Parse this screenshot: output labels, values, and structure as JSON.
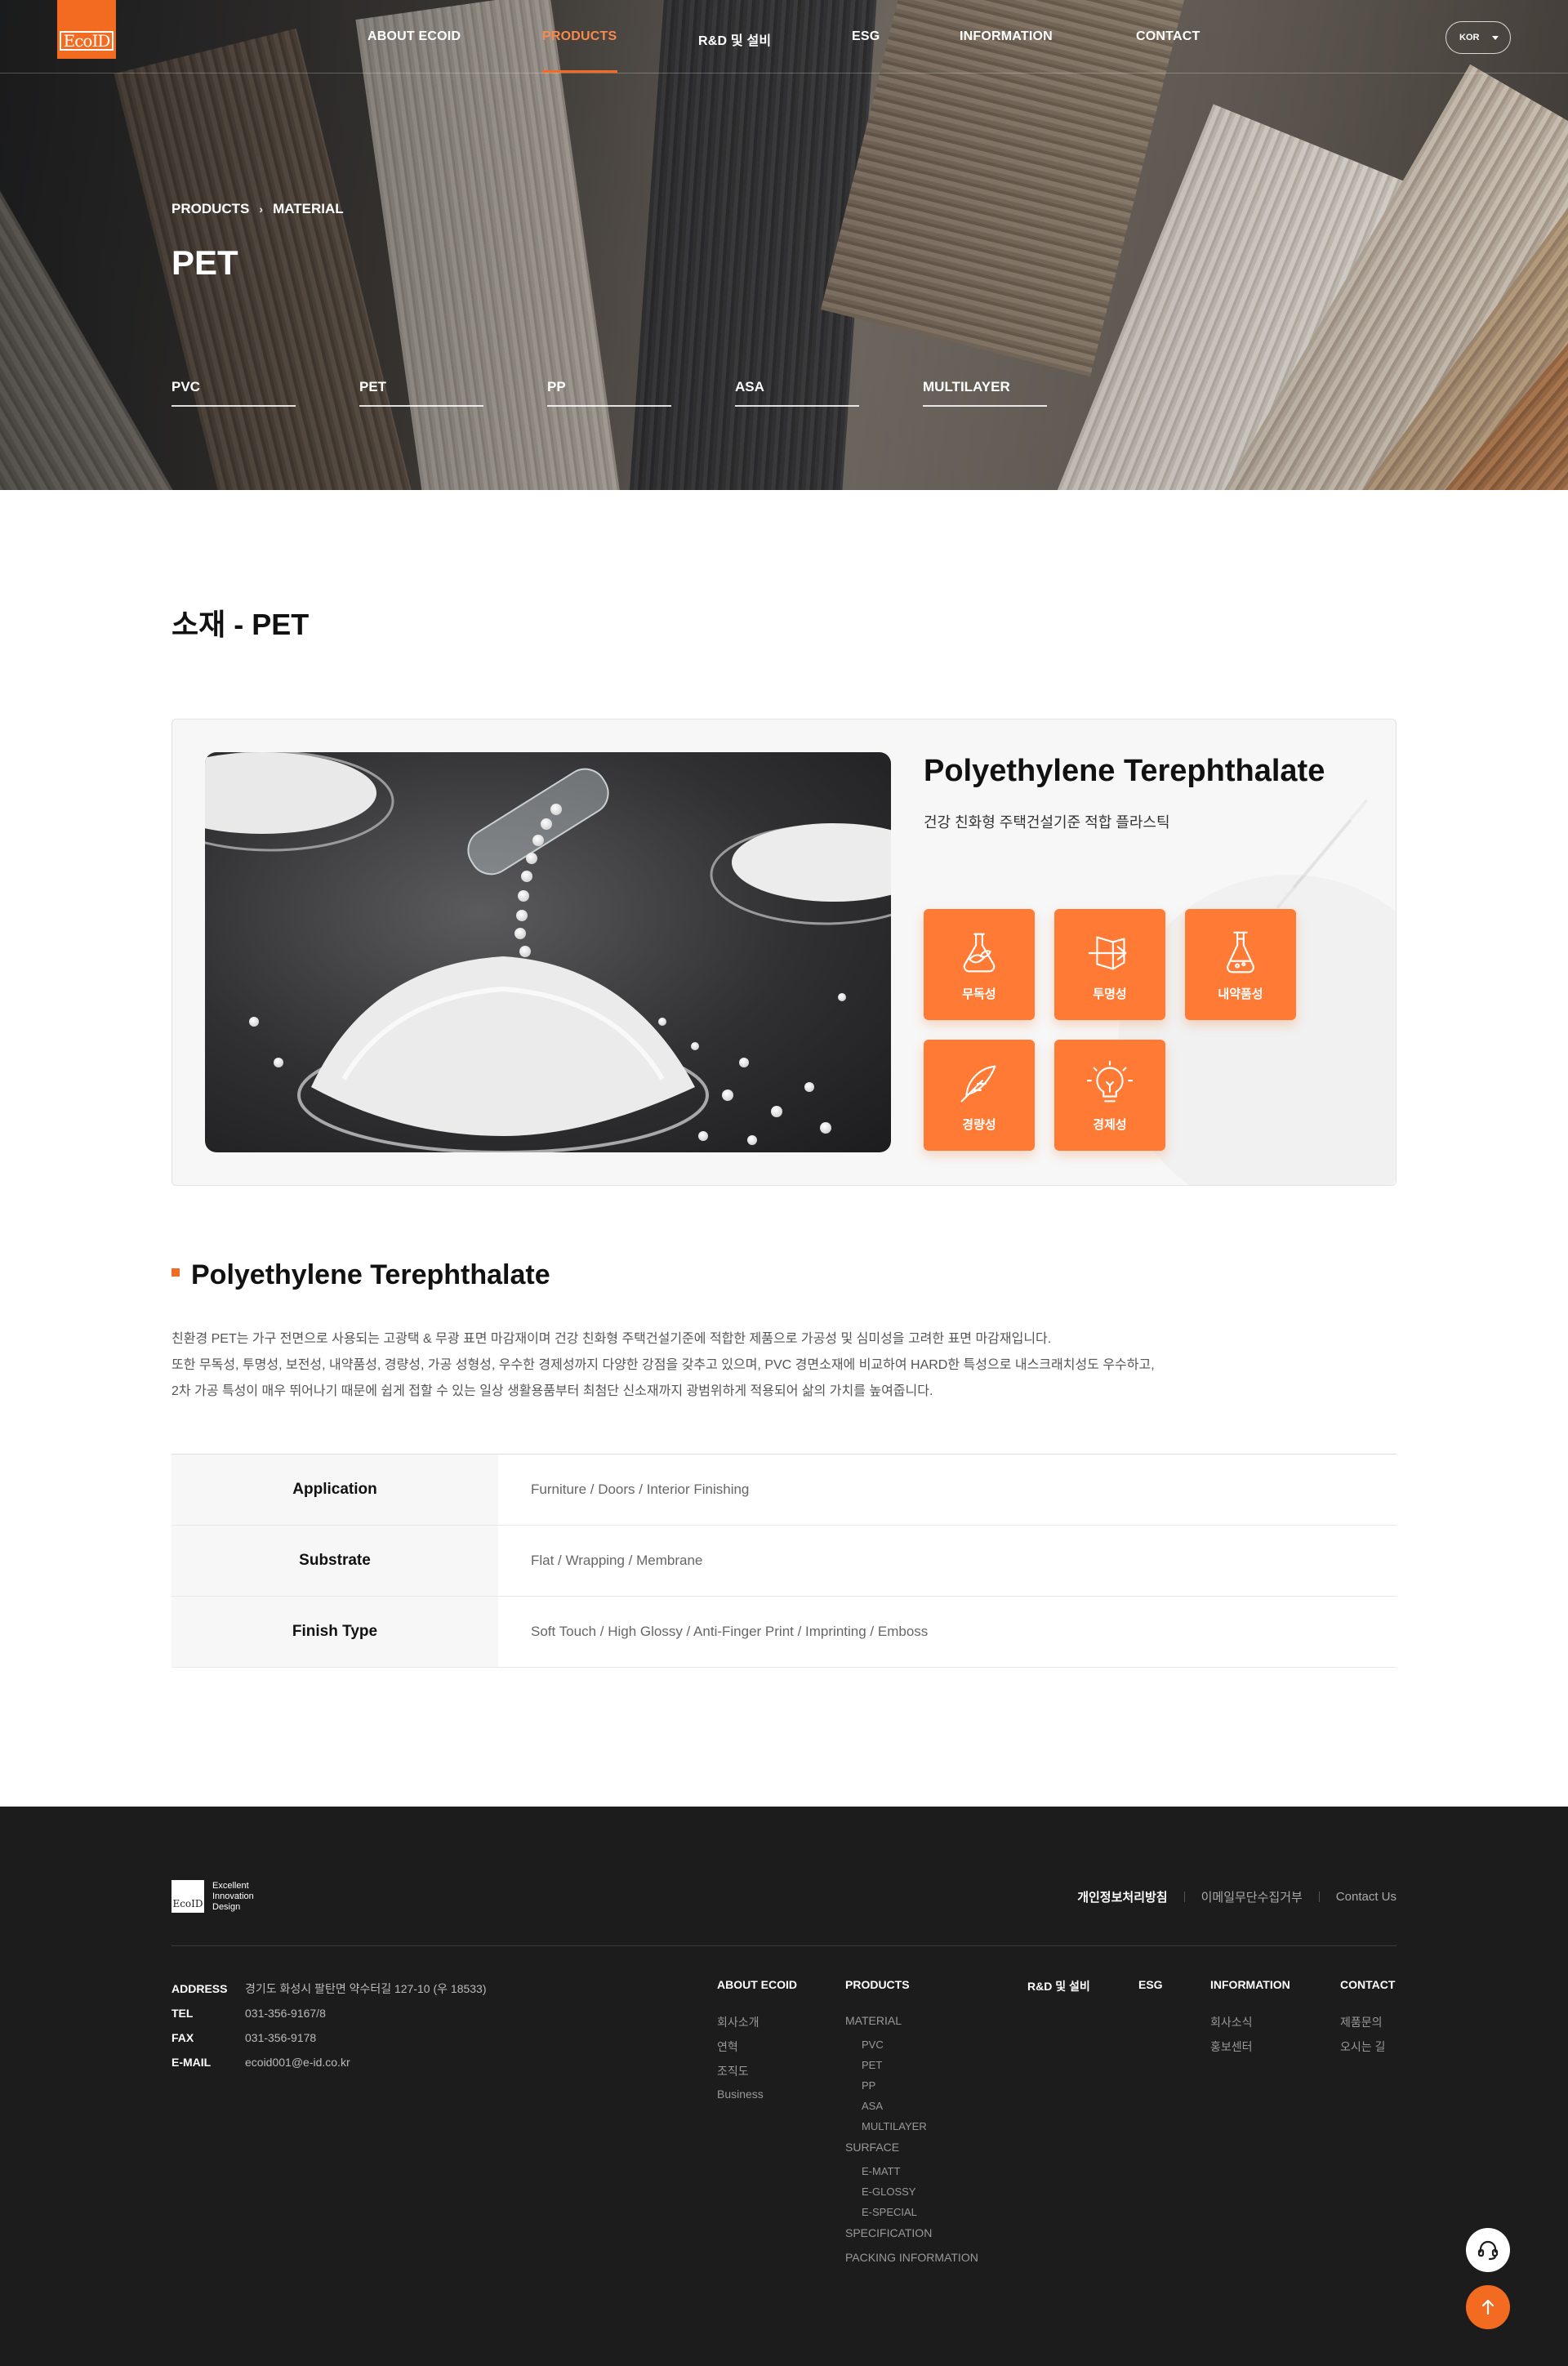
{
  "header": {
    "logo_text": "EcoID",
    "nav": [
      {
        "label": "ABOUT ECOID"
      },
      {
        "label": "PRODUCTS"
      },
      {
        "label": "R&D 및 설비"
      },
      {
        "label": "ESG"
      },
      {
        "label": "INFORMATION"
      },
      {
        "label": "CONTACT"
      }
    ],
    "active_nav": "PRODUCTS",
    "language": "KOR"
  },
  "hero": {
    "breadcrumb": [
      "PRODUCTS",
      "MATERIAL"
    ],
    "title": "PET",
    "subnav": [
      {
        "label": "PVC"
      },
      {
        "label": "PET"
      },
      {
        "label": "PP"
      },
      {
        "label": "ASA"
      },
      {
        "label": "MULTILAYER"
      }
    ]
  },
  "main": {
    "section_title": "소재 - PET",
    "product": {
      "name": "Polyethylene Terephthalate",
      "subtitle": "건강 친화형 주택건설기준 적합 플라스틱",
      "features": [
        {
          "label": "무독성",
          "icon": "flask-leaf-icon"
        },
        {
          "label": "투명성",
          "icon": "transparency-arrow-icon"
        },
        {
          "label": "내약품성",
          "icon": "chemical-flask-icon"
        },
        {
          "label": "경량성",
          "icon": "feather-icon"
        },
        {
          "label": "경제성",
          "icon": "lightbulb-icon"
        }
      ]
    },
    "detail_title": "Polyethylene Terephthalate",
    "description": [
      "친환경 PET는 가구 전면으로 사용되는 고광택 & 무광 표면 마감재이며 건강 친화형 주택건설기준에 적합한 제품으로 가공성 및 심미성을 고려한 표면 마감재입니다.",
      "또한 무독성, 투명성, 보전성, 내약품성, 경량성, 가공 성형성, 우수한 경제성까지 다양한 강점을 갖추고 있으며, PVC 경면소재에 비교하여 HARD한 특성으로 내스크래치성도 우수하고,",
      "2차 가공 특성이 매우 뛰어나기 때문에 쉽게 접할 수 있는 일상 생활용품부터 최첨단 신소재까지 광범위하게 적용되어 삶의 가치를 높여줍니다."
    ],
    "spec": [
      {
        "label": "Application",
        "value": "Furniture / Doors / Interior Finishing"
      },
      {
        "label": "Substrate",
        "value": "Flat / Wrapping / Membrane"
      },
      {
        "label": "Finish Type",
        "value": "Soft Touch / High Glossy / Anti-Finger Print / Imprinting / Emboss"
      }
    ]
  },
  "footer": {
    "logo_mark": "EcoID",
    "tagline": [
      "Excellent",
      "Innovation",
      "Design"
    ],
    "policy_links": [
      {
        "label": "개인정보처리방침"
      },
      {
        "label": "이메일무단수집거부"
      },
      {
        "label": "Contact Us"
      }
    ],
    "info": [
      {
        "key": "ADDRESS",
        "value": "경기도 화성시 팔탄면 약수터길 127-10 (우 18533)"
      },
      {
        "key": "TEL",
        "value": "031-356-9167/8"
      },
      {
        "key": "FAX",
        "value": "031-356-9178"
      },
      {
        "key": "E-MAIL",
        "value": "ecoid001@e-id.co.kr"
      }
    ],
    "sitemap": {
      "about": {
        "title": "ABOUT ECOID",
        "items": [
          "회사소개",
          "연혁",
          "조직도",
          "Business"
        ]
      },
      "products": {
        "title": "PRODUCTS",
        "material": "MATERIAL",
        "material_items": [
          "PVC",
          "PET",
          "PP",
          "ASA",
          "MULTILAYER"
        ],
        "surface": "SURFACE",
        "surface_items": [
          "E-MATT",
          "E-GLOSSY",
          "E-SPECIAL"
        ],
        "specification": "SPECIFICATION",
        "packing": "PACKING INFORMATION"
      },
      "rnd": {
        "title": "R&D 및 설비"
      },
      "esg": {
        "title": "ESG"
      },
      "information": {
        "title": "INFORMATION",
        "items": [
          "회사소식",
          "홍보센터"
        ]
      },
      "contact": {
        "title": "CONTACT",
        "items": [
          "제품문의",
          "오시는 길"
        ]
      }
    }
  },
  "colors": {
    "accent": "#f26b21",
    "feature_tile": "#ff7a34",
    "footer_bg": "#1c1c1c"
  }
}
